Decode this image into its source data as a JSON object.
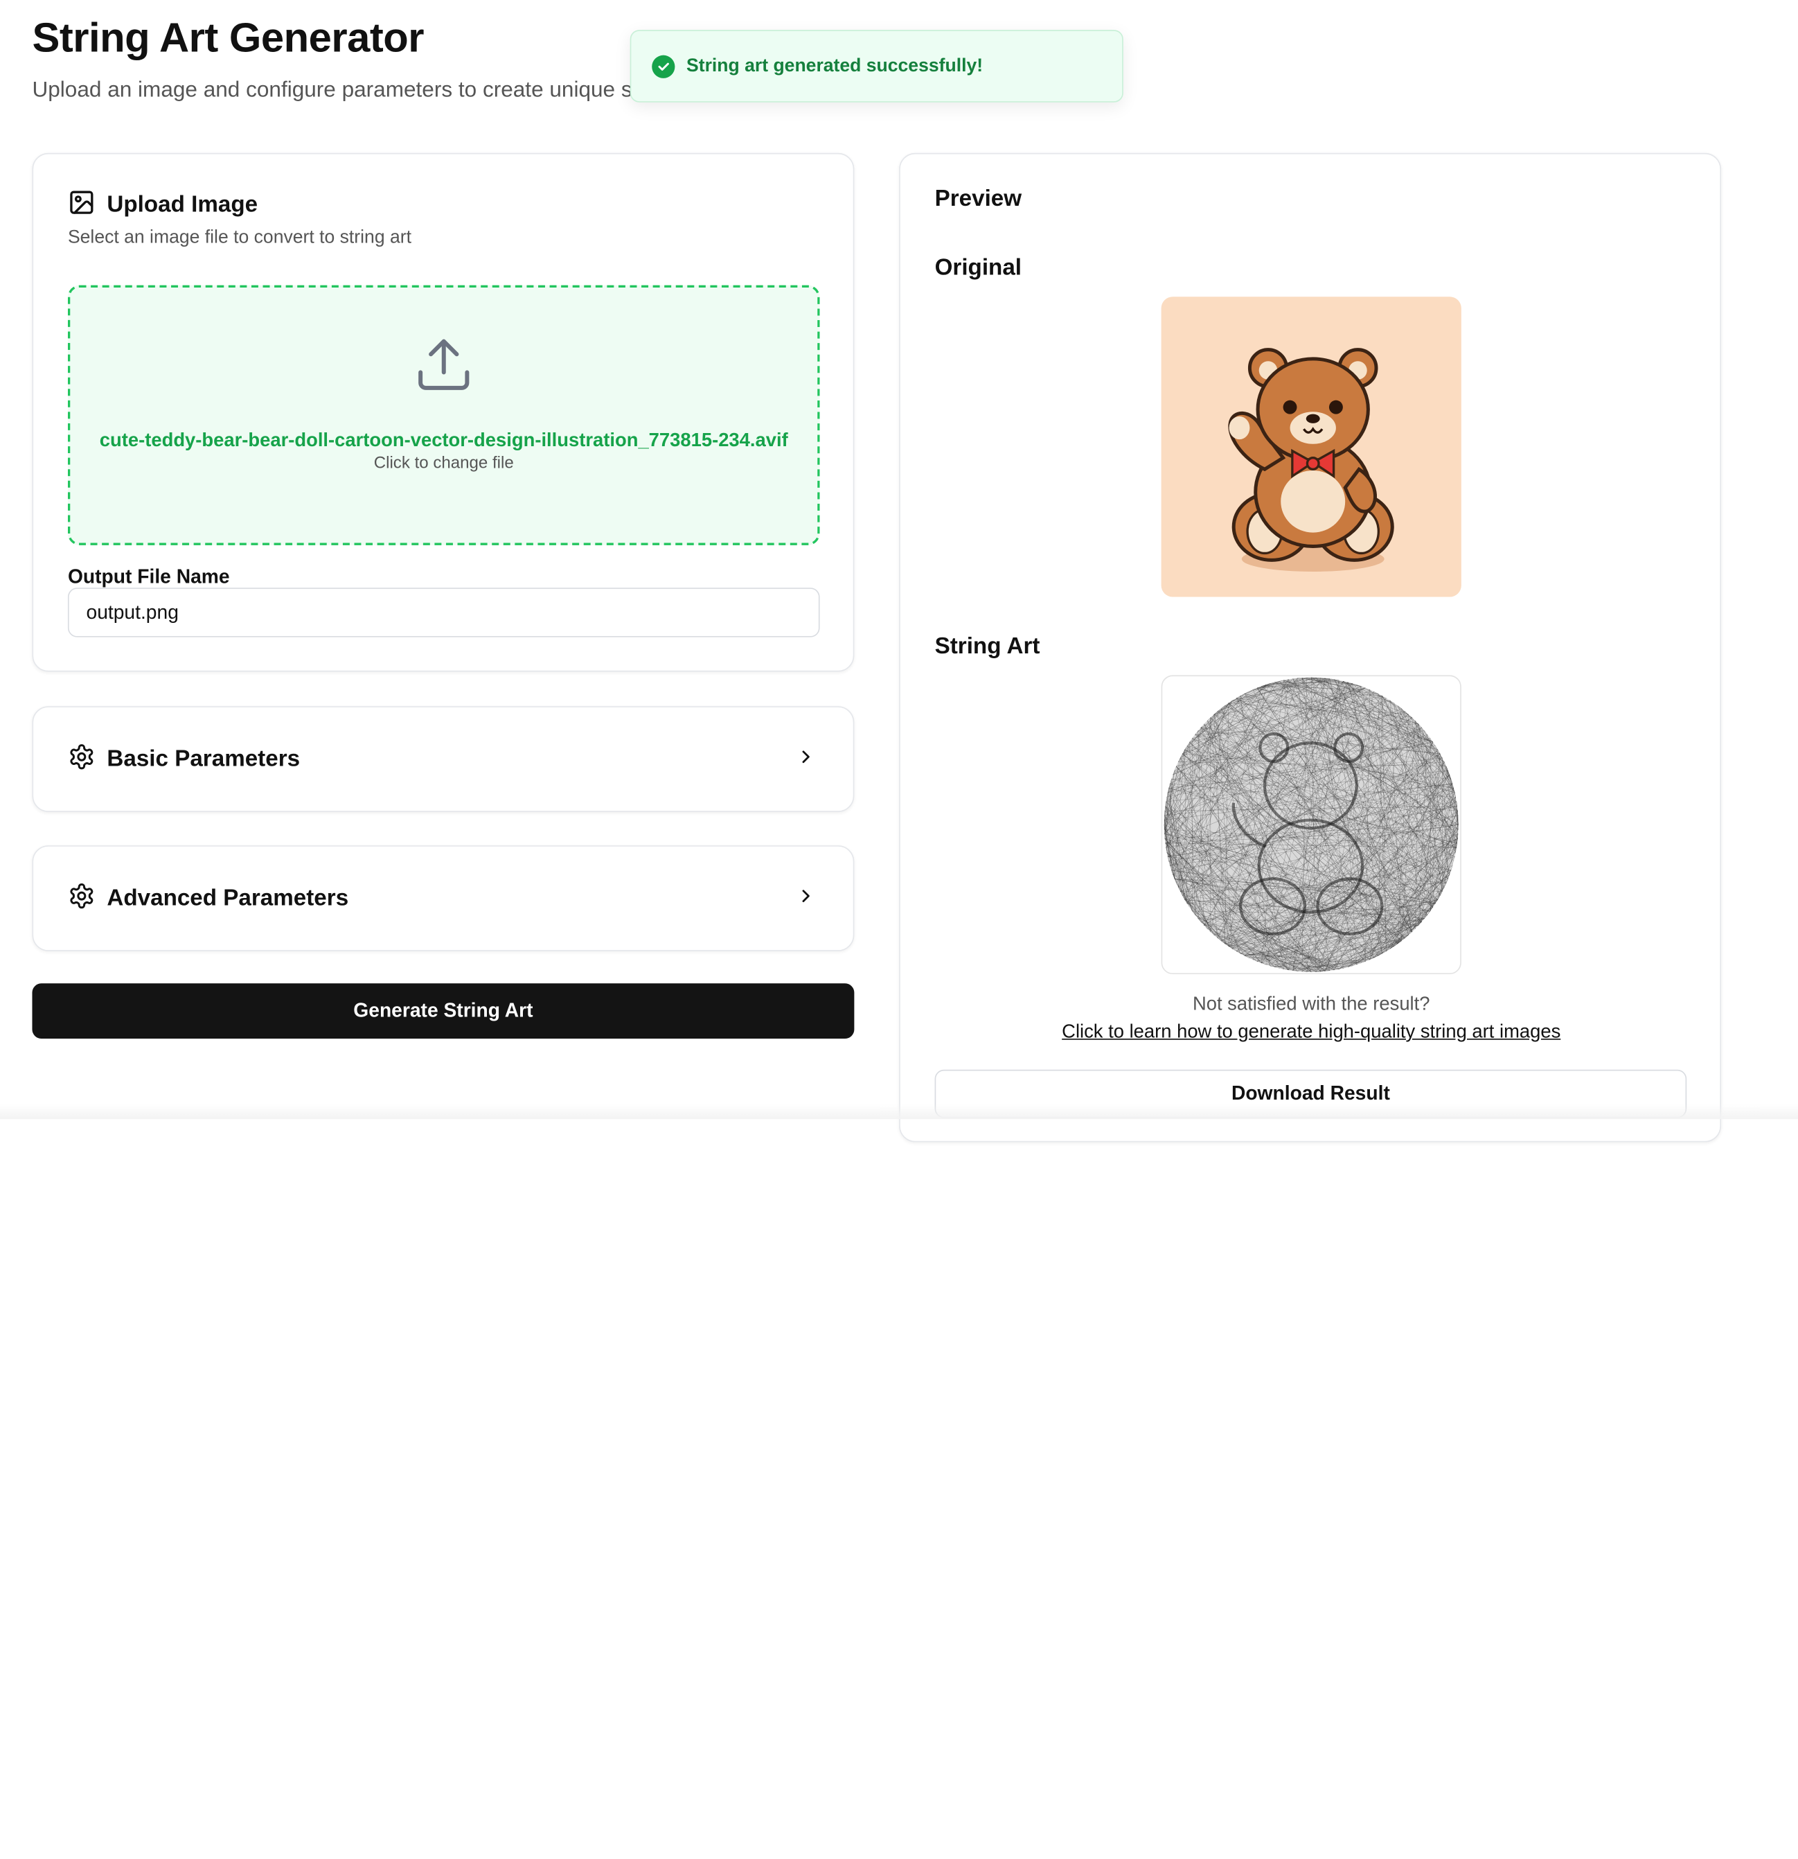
{
  "header": {
    "title": "String Art Generator",
    "subtitle": "Upload an image and configure parameters to create unique string art"
  },
  "toast": {
    "message": "String art generated successfully!",
    "icon": "check-circle-icon",
    "color": "#16a34a"
  },
  "upload": {
    "title": "Upload Image",
    "description": "Select an image file to convert to string art",
    "icon": "image-icon",
    "dropzone": {
      "icon": "upload-icon",
      "file_name": "cute-teddy-bear-bear-doll-cartoon-vector-design-illustration_773815-234.avif",
      "hint": "Click to change file"
    },
    "output_label": "Output File Name",
    "output_value": "output.png"
  },
  "sections": {
    "basic": {
      "title": "Basic Parameters",
      "icon": "gear-icon"
    },
    "advanced": {
      "title": "Advanced Parameters",
      "icon": "gear-icon"
    }
  },
  "generate_button": "Generate String Art",
  "preview": {
    "title": "Preview",
    "original_label": "Original",
    "string_art_label": "String Art",
    "not_satisfied": "Not satisfied with the result?",
    "learn_link": "Click to learn how to generate high-quality string art images",
    "download_button": "Download Result"
  },
  "colors": {
    "accent_green": "#22c55e",
    "button_dark": "#141414",
    "original_bg": "#fbdcc1"
  }
}
